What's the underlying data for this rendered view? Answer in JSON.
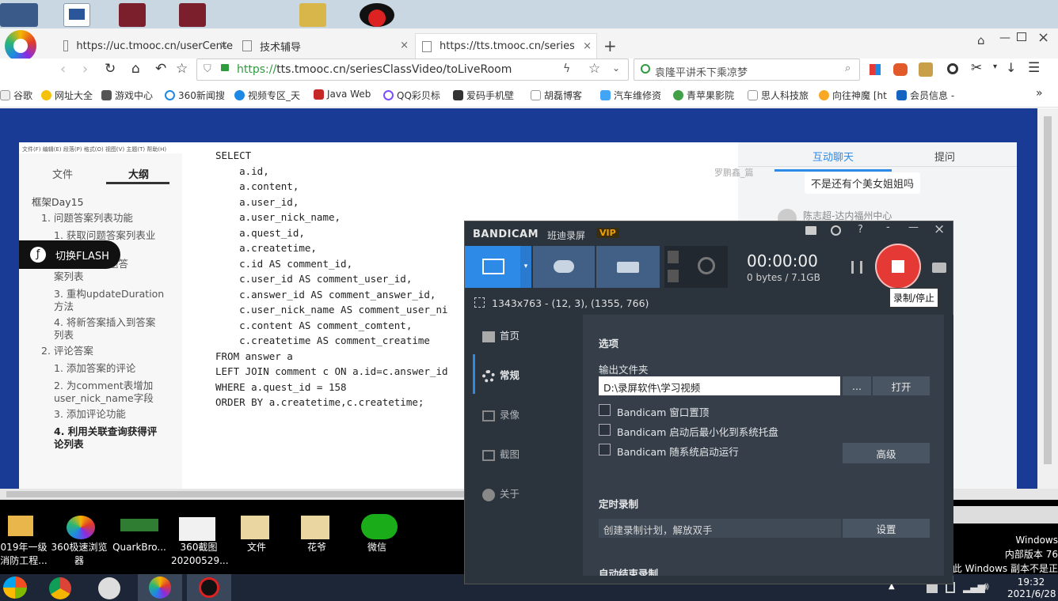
{
  "desktop_bottom_icons": [
    "019年一级消防工程...",
    "360极速浏览器",
    "QuarkBro...",
    "360截图20200529...",
    "文件",
    "花爷",
    "微信"
  ],
  "browser": {
    "tabs": [
      {
        "label": "https://uc.tmooc.cn/userCente",
        "close": "×"
      },
      {
        "label": "技术辅导",
        "close": "×"
      },
      {
        "label": "https://tts.tmooc.cn/series(",
        "close": "×"
      }
    ],
    "new_tab": "+",
    "url": {
      "scheme": "https://",
      "rest": "tts.tmooc.cn/seriesClassVideo/toLiveRoom"
    },
    "search": "袁隆平讲禾下乘凉梦",
    "bookmarks": [
      "谷歌",
      "网址大全",
      "游戏中心",
      "360新闻搜",
      "视频专区_天",
      "Java Web",
      "QQ彩贝标",
      "爱码手机壁",
      "胡磊博客",
      "汽车维修资",
      "青苹果影院",
      "思人科技旅",
      "向往神魔 [ht",
      "会员信息 -"
    ],
    "more": "»"
  },
  "page": {
    "menu": "文件(F)  编辑(E)  段落(P)  格式(O)  视图(V)  主题(T)  帮助(H)",
    "left_tabs": [
      "文件",
      "大纲"
    ],
    "outline": [
      {
        "t": "框架Day15",
        "lvl": 0
      },
      {
        "t": "1. 问题答案列表功能",
        "lvl": 1
      },
      {
        "t": "1. 获取问题答案列表业",
        "lvl": 2
      },
      {
        "t": "示问题答",
        "lvl": 3
      },
      {
        "t": "案列表",
        "lvl": 2
      },
      {
        "t": "3. 重构updateDuration",
        "lvl": 2
      },
      {
        "t": "方法",
        "lvl": 2
      },
      {
        "t": "4. 将新答案插入到答案",
        "lvl": 2
      },
      {
        "t": "列表",
        "lvl": 2
      },
      {
        "t": "2. 评论答案",
        "lvl": 1
      },
      {
        "t": "1. 添加答案的评论",
        "lvl": 2
      },
      {
        "t": "2. 为comment表增加",
        "lvl": 2
      },
      {
        "t": "user_nick_name字段",
        "lvl": 2
      },
      {
        "t": "3. 添加评论功能",
        "lvl": 2
      },
      {
        "t": "4. 利用关联查询获得评",
        "lvl": 4
      },
      {
        "t": "论列表",
        "lvl": 4
      }
    ],
    "flash_btn": "切换FLASH",
    "code": "SELECT\n    a.id,\n    a.content,\n    a.user_id,\n    a.user_nick_name,\n    a.quest_id,\n    a.createtime,\n    c.id AS comment_id,\n    c.user_id AS comment_user_id,\n    c.answer_id AS comment_answer_id,\n    c.user_nick_name AS comment_user_ni\n    c.content AS comment_comtent,\n    c.createtime AS comment_creatime\nFROM answer a\nLEFT JOIN comment c ON a.id=c.answer_id\nWHERE a.quest_id = 158\nORDER BY a.createtime,c.createtime;",
    "chat_tabs": [
      "互动聊天",
      "提问"
    ],
    "chat_name1": "罗鹏鑫_篇",
    "chat_msg": "不是还有个美女姐姐吗",
    "chat_name2": "陈志超-达内福州中心"
  },
  "bandicam": {
    "logo": "BANDICAM",
    "ban_label": "班迪录屏",
    "vip": "VIP",
    "timer": "00:00:00",
    "size": "0 bytes / 7.1GB",
    "area_info": "1343x763 - (12, 3), (1355, 766)",
    "tooltip": "录制/停止",
    "nav": [
      "首页",
      "常规",
      "录像",
      "截图",
      "关于"
    ],
    "options_title": "选项",
    "output_label": "输出文件夹",
    "output_path": "D:\\录屏软件\\学习视频",
    "dots": "...",
    "open": "打开",
    "checks": [
      "Bandicam 窗口置顶",
      "Bandicam 启动后最小化到系统托盘",
      "Bandicam 随系统启动运行"
    ],
    "advanced": "高级",
    "sched_title": "定时录制",
    "sched_text": "创建录制计划，解放双手",
    "settings": "设置",
    "auto_title": "自动结束录制",
    "colors": {
      "accent": "#2d8ae6",
      "record": "#e53935",
      "panel": "#2b333d"
    }
  },
  "taskbar": {
    "time": "19:32",
    "date": "2021/6/28",
    "win_notice": [
      "Windows",
      "内部版本 76",
      "此 Windows 副本不是正"
    ]
  }
}
